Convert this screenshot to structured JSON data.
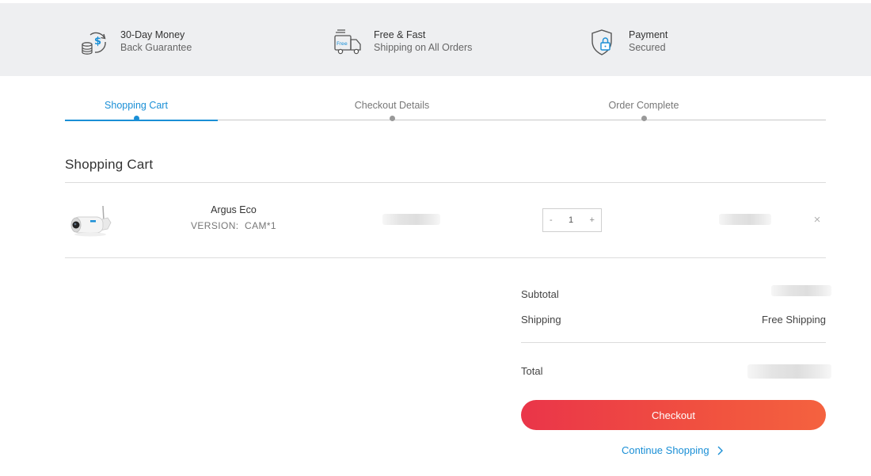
{
  "features": [
    {
      "icon": "money-back-icon",
      "line1": "30-Day Money",
      "line2": "Back Guarantee"
    },
    {
      "icon": "free-shipping-truck-icon",
      "line1": "Free & Fast",
      "line2": "Shipping on All Orders",
      "badge": "Free"
    },
    {
      "icon": "secure-shield-lock-icon",
      "line1": "Payment",
      "line2": "Secured"
    }
  ],
  "steps": [
    {
      "label": "Shopping Cart",
      "active": true
    },
    {
      "label": "Checkout Details",
      "active": false
    },
    {
      "label": "Order Complete",
      "active": false
    }
  ],
  "cart": {
    "title": "Shopping Cart",
    "items": [
      {
        "name": "Argus Eco",
        "version_label": "VERSION:",
        "version_value": "CAM*1",
        "quantity": "1",
        "qty_minus": "-",
        "qty_plus": "+",
        "remove_label": "×"
      }
    ]
  },
  "summary": {
    "subtotal_label": "Subtotal",
    "shipping_label": "Shipping",
    "shipping_value": "Free Shipping",
    "total_label": "Total",
    "checkout_label": "Checkout",
    "continue_label": "Continue Shopping"
  },
  "colors": {
    "accent": "#1a8fd6",
    "checkout_start": "#ea3549",
    "checkout_end": "#f4623f",
    "band_bg": "#eeeff1"
  }
}
